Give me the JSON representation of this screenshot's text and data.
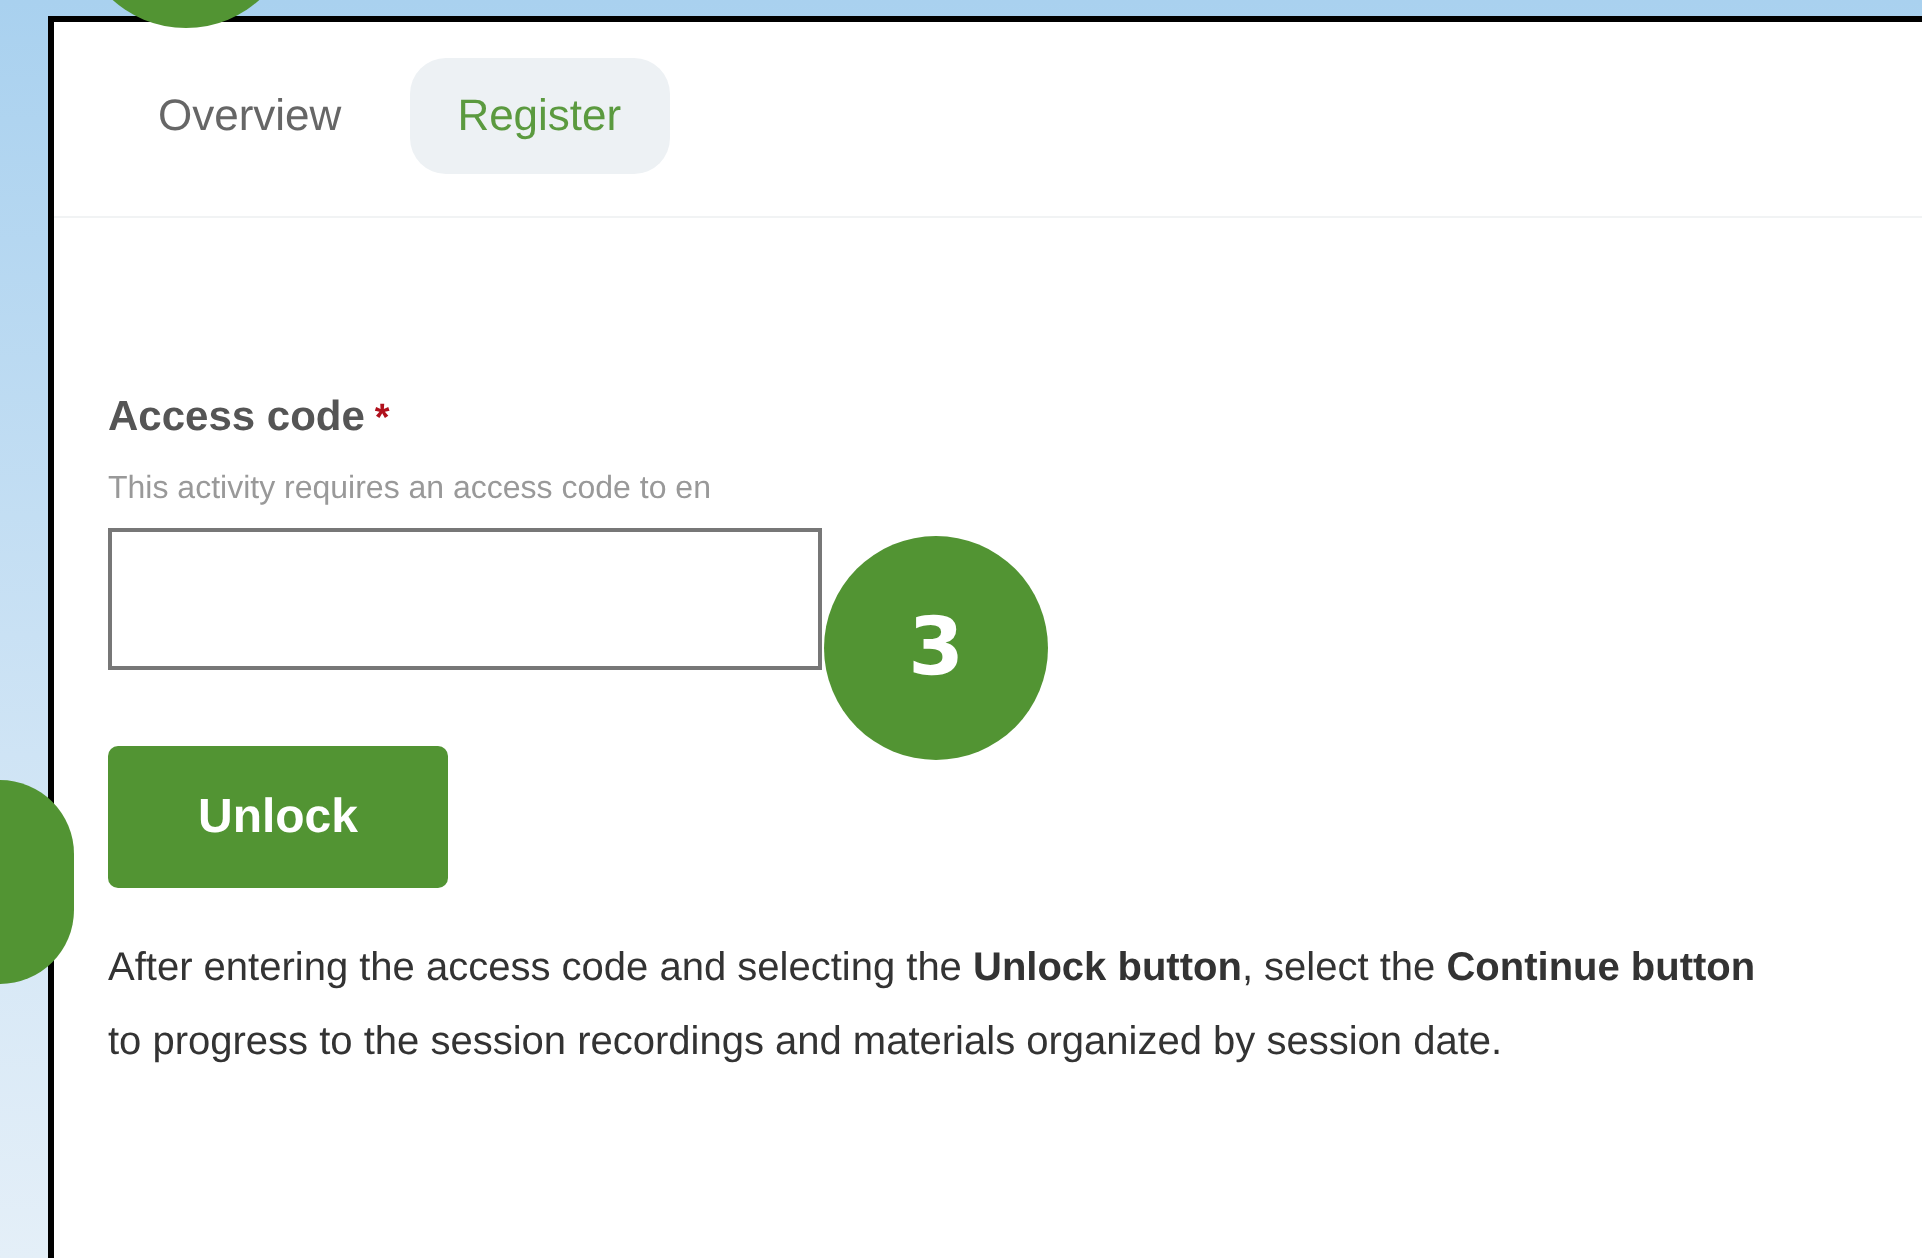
{
  "tabs": [
    {
      "label": "Overview",
      "selected": false
    },
    {
      "label": "Register",
      "selected": true
    }
  ],
  "access_code": {
    "label": "Access code",
    "required_mark": "*",
    "hint": "This activity requires an access code to en"
  },
  "unlock_button": "Unlock",
  "instructions": "After entering the access code and selecting the **Unlock button**, select the **Continue button** to progress to the session recordings and materials organized by session date.",
  "callouts": [
    {
      "kind": "plain"
    },
    {
      "kind": "number",
      "label": "3"
    },
    {
      "kind": "plain"
    }
  ]
}
